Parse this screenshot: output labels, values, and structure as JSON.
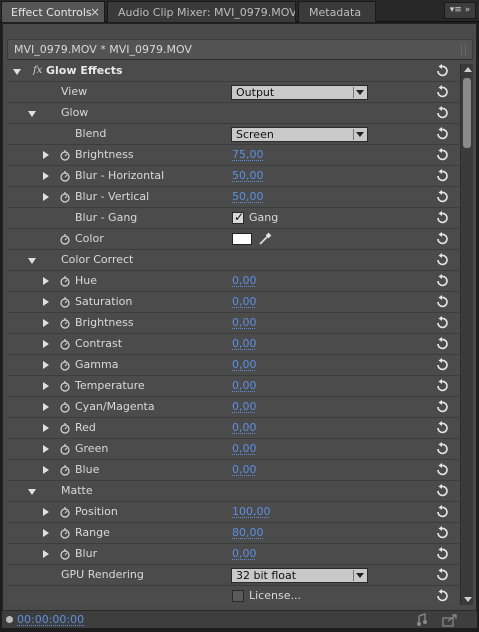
{
  "tabs": [
    {
      "label": "Effect Controls",
      "active": true,
      "closable": true
    },
    {
      "label": "Audio Clip Mixer: MVI_0979.MOV",
      "active": false
    },
    {
      "label": "Metadata",
      "active": false
    }
  ],
  "panel_menu_icon": "panel-menu-icon",
  "clip_header": "MVI_0979.MOV * MVI_0979.MOV",
  "effect": {
    "fx_symbol": "fx",
    "name": "Glow Effects"
  },
  "rows": {
    "view": {
      "label": "View",
      "value": "Output"
    },
    "glow_group": {
      "label": "Glow"
    },
    "blend": {
      "label": "Blend",
      "value": "Screen"
    },
    "brightness": {
      "label": "Brightness",
      "value": "75,00"
    },
    "blur_h": {
      "label": "Blur - Horizontal",
      "value": "50,00"
    },
    "blur_v": {
      "label": "Blur - Vertical",
      "value": "50,00"
    },
    "blur_gang": {
      "label": "Blur - Gang",
      "check_label": "Gang",
      "checked": true
    },
    "color": {
      "label": "Color",
      "swatch": "#ffffff"
    },
    "color_correct": {
      "label": "Color Correct"
    },
    "hue": {
      "label": "Hue",
      "value": "0,00"
    },
    "saturation": {
      "label": "Saturation",
      "value": "0,00"
    },
    "cc_brightness": {
      "label": "Brightness",
      "value": "0,00"
    },
    "contrast": {
      "label": "Contrast",
      "value": "0,00"
    },
    "gamma": {
      "label": "Gamma",
      "value": "0,00"
    },
    "temperature": {
      "label": "Temperature",
      "value": "0,00"
    },
    "cyan_magenta": {
      "label": "Cyan/Magenta",
      "value": "0,00"
    },
    "red": {
      "label": "Red",
      "value": "0,00"
    },
    "green": {
      "label": "Green",
      "value": "0,00"
    },
    "blue": {
      "label": "Blue",
      "value": "0,00"
    },
    "matte": {
      "label": "Matte"
    },
    "position": {
      "label": "Position",
      "value": "100,00"
    },
    "range": {
      "label": "Range",
      "value": "80,00"
    },
    "matte_blur": {
      "label": "Blur",
      "value": "0,00"
    },
    "gpu": {
      "label": "GPU Rendering",
      "value": "32 bit float"
    },
    "license": {
      "label": "License...",
      "checked": false
    }
  },
  "footer": {
    "timecode": "00:00:00:00"
  },
  "colors": {
    "value_link": "#5d8fe0",
    "panel_bg": "#4a4a4a",
    "swatch": "#ffffff"
  }
}
